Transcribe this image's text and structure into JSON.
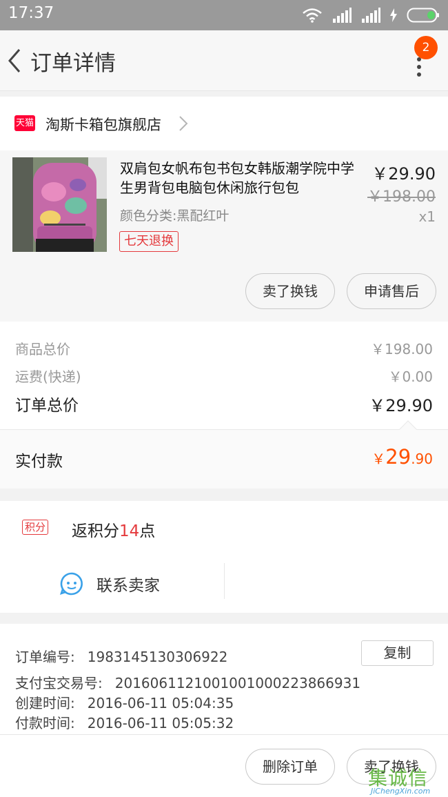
{
  "status_bar": {
    "time": "17:37"
  },
  "header": {
    "title": "订单详情",
    "badge": "2"
  },
  "store": {
    "badge": "天猫",
    "name": "淘斯卡箱包旗舰店"
  },
  "item": {
    "name": "双肩包女帆布包书包女韩版潮学院中学生男背包电脑包休闲旅行包包",
    "spec": "颜色分类:黑配红叶",
    "tag": "七天退换",
    "price": "￥29.90",
    "original_price": "￥198.00",
    "quantity": "x1",
    "buttons": {
      "sell": "卖了换钱",
      "after_sale": "申请售后"
    }
  },
  "summary": {
    "goods_total_label": "商品总价",
    "goods_total": "￥198.00",
    "shipping_label": "运费(快递)",
    "shipping": "￥0.00",
    "order_total_label": "订单总价",
    "order_total": "￥29.90"
  },
  "payment": {
    "label": "实付款",
    "yen": "￥",
    "whole": "29",
    "cents": ".90"
  },
  "points": {
    "badge": "积分",
    "prefix": "返积分",
    "value": "14",
    "suffix": "点"
  },
  "contact": {
    "label": "联系卖家"
  },
  "order_info": {
    "order_no_label": "订单编号:",
    "order_no": "1983145130306922",
    "copy_label": "复制",
    "alipay_label": "支付宝交易号:",
    "alipay_no": "2016061121001001000223866931",
    "created_label": "创建时间:",
    "created": "2016-06-11 05:04:35",
    "paid_label": "付款时间:",
    "paid": "2016-06-11 05:05:32"
  },
  "bottom_bar": {
    "delete": "删除订单",
    "sell": "卖了换钱"
  },
  "watermark": {
    "logo": "集诚信",
    "site": "JiChengXin.com"
  },
  "colors": {
    "accent": "#ff5000",
    "tag_red": "#e4393c",
    "tmall_red": "#ff0036"
  }
}
